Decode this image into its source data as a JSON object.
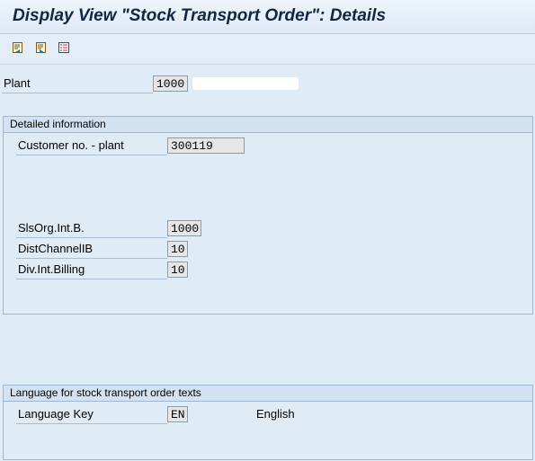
{
  "window": {
    "title": "Display View \"Stock Transport Order\": Details"
  },
  "toolbar": {
    "buttons": [
      {
        "icon": "previous-entry-icon"
      },
      {
        "icon": "next-entry-icon"
      },
      {
        "icon": "variable-list-icon"
      }
    ]
  },
  "plant": {
    "label": "Plant",
    "value": "1000"
  },
  "detailed": {
    "header": "Detailed information",
    "customer_label": "Customer no. - plant",
    "customer_value": "300119",
    "salesorg_label": "SlsOrg.Int.B.",
    "salesorg_value": "1000",
    "distchannel_label": "DistChannelIB",
    "distchannel_value": "10",
    "division_label": "Div.Int.Billing",
    "division_value": "10"
  },
  "language": {
    "header": "Language for stock transport order texts",
    "key_label": "Language Key",
    "key_value": "EN",
    "key_text": "English"
  }
}
